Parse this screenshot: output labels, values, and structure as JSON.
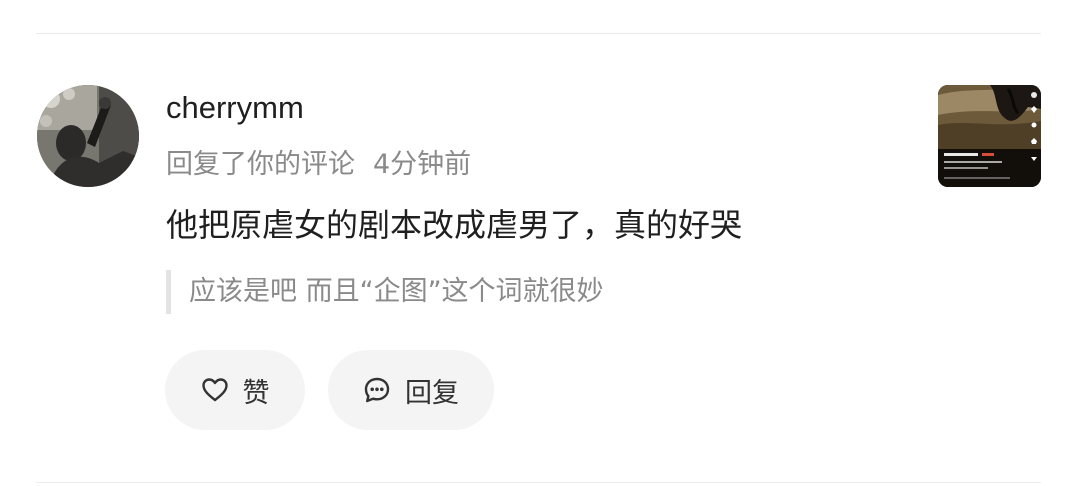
{
  "comment": {
    "username": "cherrymm",
    "action": "回复了你的评论",
    "time": "4分钟前",
    "text": "他把原虐女的剧本改成虐男了，真的好哭",
    "quoted": "应该是吧 而且“企图”这个词就很妙"
  },
  "actions": {
    "like_label": "赞",
    "reply_label": "回复"
  },
  "icons": {
    "like": "heart-icon",
    "reply": "chat-bubble-icon"
  }
}
